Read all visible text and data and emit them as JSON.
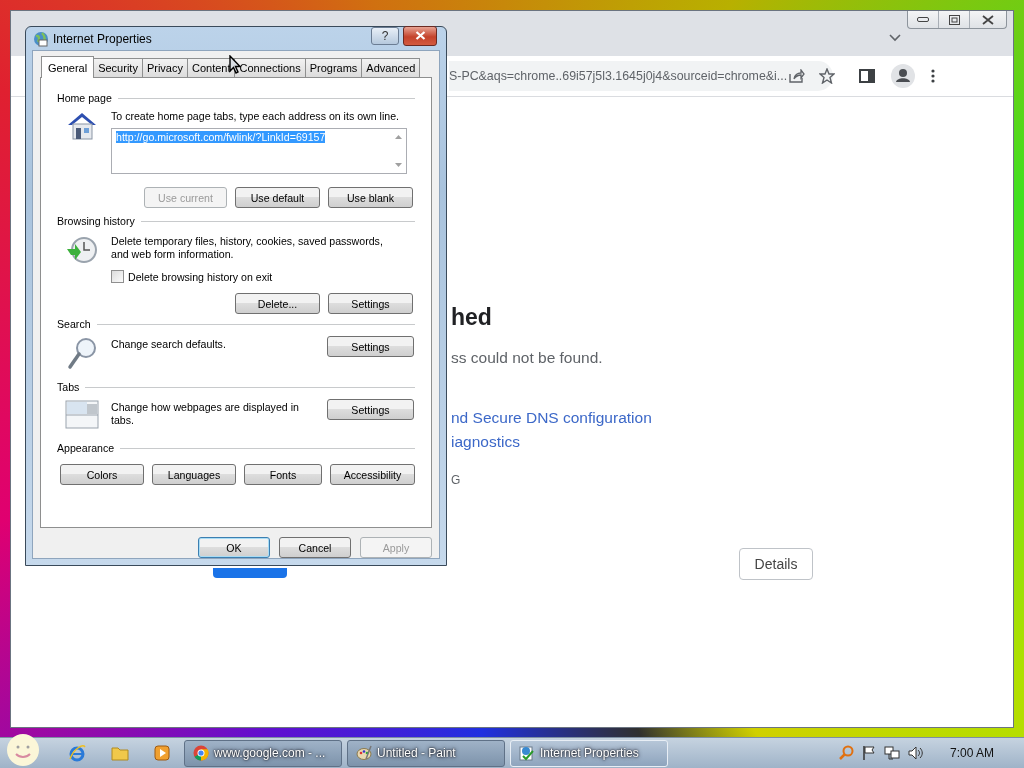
{
  "chrome_window": {
    "address_text": "S-PC&aqs=chrome..69i57j5l3.1645j0j4&sourceid=chrome&i...",
    "heading": "hed",
    "message": "ss could not be found.",
    "links": [
      "nd Secure DNS configuration",
      "iagnostics"
    ],
    "error_code": "G",
    "details_button": "Details"
  },
  "dialog": {
    "title": "Internet Properties",
    "help_button": "?",
    "tabs": [
      {
        "label": "General",
        "selected": true
      },
      {
        "label": "Security",
        "selected": false
      },
      {
        "label": "Privacy",
        "selected": false
      },
      {
        "label": "Content",
        "selected": false
      },
      {
        "label": "Connections",
        "selected": false
      },
      {
        "label": "Programs",
        "selected": false
      },
      {
        "label": "Advanced",
        "selected": false
      }
    ],
    "sections": [
      {
        "kind": "home",
        "title": "Home page",
        "text": "To create home page tabs, type each address on its own line.",
        "field": {
          "value": "http://go.microsoft.com/fwlink/?LinkId=69157",
          "text_selected": true
        },
        "buttons": [
          {
            "label": "Use current",
            "disabled": true
          },
          {
            "label": "Use default",
            "disabled": false
          },
          {
            "label": "Use blank",
            "disabled": false
          }
        ]
      },
      {
        "kind": "history",
        "title": "Browsing history",
        "text": "Delete temporary files, history, cookies, saved passwords, and web form information.",
        "checkbox": {
          "label": "Delete browsing history on exit",
          "checked": false
        },
        "buttons": [
          {
            "label": "Delete...",
            "disabled": false
          },
          {
            "label": "Settings",
            "disabled": false
          }
        ]
      },
      {
        "kind": "inline",
        "title": "Search",
        "text": "Change search defaults.",
        "buttons": [
          {
            "label": "Settings",
            "disabled": false
          }
        ]
      },
      {
        "kind": "inline",
        "title": "Tabs",
        "text": "Change how webpages are displayed in tabs.",
        "buttons": [
          {
            "label": "Settings",
            "disabled": false
          }
        ]
      },
      {
        "kind": "buttons",
        "title": "Appearance",
        "buttons": [
          {
            "label": "Colors",
            "disabled": false
          },
          {
            "label": "Languages",
            "disabled": false
          },
          {
            "label": "Fonts",
            "disabled": false
          },
          {
            "label": "Accessibility",
            "disabled": false
          }
        ]
      }
    ],
    "buttons": [
      {
        "label": "OK",
        "default": true,
        "disabled": false
      },
      {
        "label": "Cancel",
        "default": false,
        "disabled": false
      },
      {
        "label": "Apply",
        "default": false,
        "disabled": true
      }
    ]
  },
  "taskbar": {
    "tasks": [
      {
        "label": "www.google.com - ...",
        "selected": false
      },
      {
        "label": "Untitled - Paint",
        "selected": false
      },
      {
        "label": "Internet Properties",
        "selected": true
      }
    ],
    "clock": "7:00 AM"
  }
}
